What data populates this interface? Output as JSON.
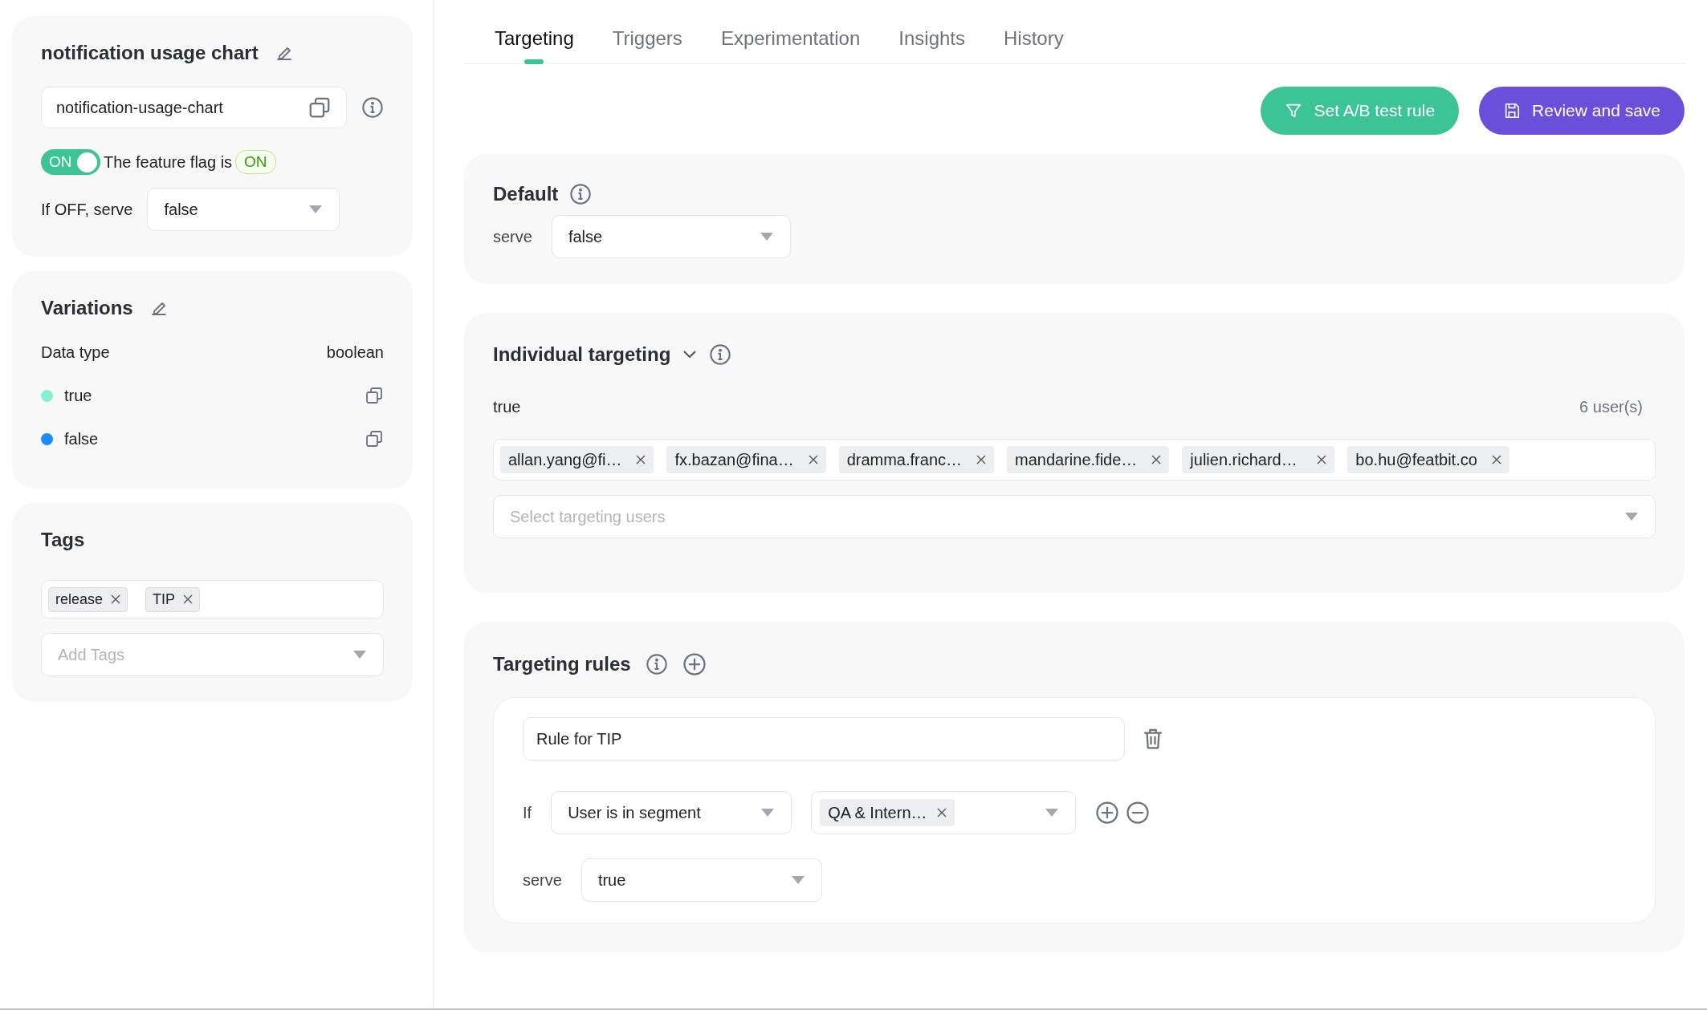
{
  "flag": {
    "name": "notification usage chart",
    "key": "notification-usage-chart",
    "toggle": {
      "on": true,
      "label": "ON"
    },
    "status_text": "The feature flag is",
    "status_badge": "ON",
    "off_label": "If OFF, serve",
    "off_value": "false"
  },
  "variations": {
    "title": "Variations",
    "data_type_label": "Data type",
    "data_type": "boolean",
    "items": [
      {
        "value": "true",
        "color": "#86efd4"
      },
      {
        "value": "false",
        "color": "#1a8cff"
      }
    ]
  },
  "tags": {
    "title": "Tags",
    "items": [
      "release",
      "TIP"
    ],
    "placeholder": "Add Tags"
  },
  "tabs": [
    {
      "label": "Targeting",
      "selected": true
    },
    {
      "label": "Triggers",
      "selected": false
    },
    {
      "label": "Experimentation",
      "selected": false
    },
    {
      "label": "Insights",
      "selected": false
    },
    {
      "label": "History",
      "selected": false
    }
  ],
  "actions": [
    {
      "label": "Set A/B test rule",
      "kind": "ab"
    },
    {
      "label": "Review and save",
      "kind": "save"
    }
  ],
  "default": {
    "title": "Default",
    "serve_label": "serve",
    "value": "false"
  },
  "individual": {
    "title": "Individual targeting",
    "variation": "true",
    "count": "6 user(s)",
    "users": [
      "allan.yang@fi…",
      "fx.bazan@fina…",
      "dramma.franc…",
      "mandarine.fide…",
      "julien.richard…",
      "bo.hu@featbit.co"
    ],
    "placeholder": "Select targeting users"
  },
  "rules": {
    "title": "Targeting rules",
    "items": [
      {
        "name": "Rule for TIP",
        "if_label": "If",
        "condition": "User is in segment",
        "segments": [
          "QA & Intern…"
        ],
        "serve_label": "serve",
        "serve": "true"
      }
    ]
  }
}
